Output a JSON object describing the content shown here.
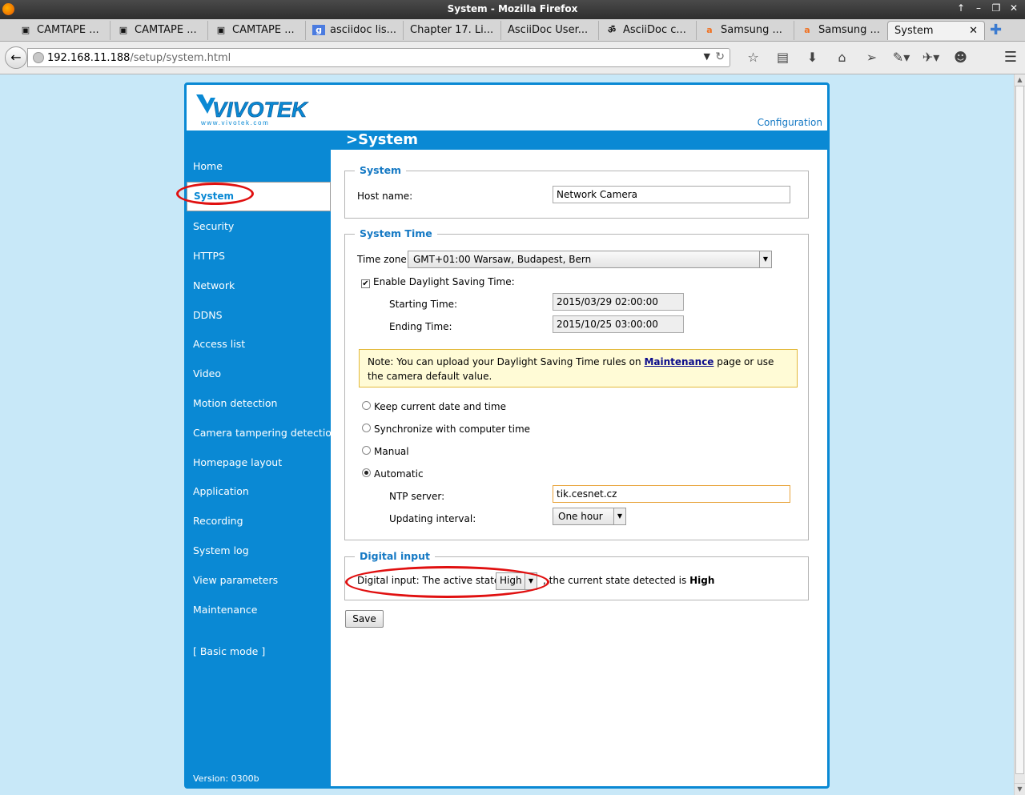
{
  "window": {
    "title": "System - Mozilla Firefox"
  },
  "tabs": [
    {
      "icon": "▣",
      "label": "CAMTAPE ..."
    },
    {
      "icon": "▣",
      "label": "CAMTAPE ..."
    },
    {
      "icon": "▣",
      "label": "CAMTAPE ..."
    },
    {
      "icon": "g",
      "label": "asciidoc lis..."
    },
    {
      "icon": "",
      "label": "Chapter 17. Li..."
    },
    {
      "icon": "",
      "label": "AsciiDoc User..."
    },
    {
      "icon": "ॐ",
      "label": "AsciiDoc c..."
    },
    {
      "icon": "a",
      "label": "Samsung ..."
    },
    {
      "icon": "a",
      "label": "Samsung ..."
    },
    {
      "icon": "",
      "label": "System"
    }
  ],
  "address": {
    "host": "192.168.11.188",
    "path": "/setup/system.html"
  },
  "page": {
    "config_link": "Configuration",
    "title": ">System",
    "version": "Version: 0300b"
  },
  "sidebar": {
    "items": [
      "Home",
      "System",
      "Security",
      "HTTPS",
      "Network",
      "DDNS",
      "Access list",
      "Video",
      "Motion detection",
      "Camera tampering detection",
      "Homepage layout",
      "Application",
      "Recording",
      "System log",
      "View parameters",
      "Maintenance"
    ],
    "basic_mode": "[ Basic mode ]"
  },
  "system": {
    "legend": "System",
    "host_label": "Host name:",
    "host_value": "Network Camera"
  },
  "time": {
    "legend": "System Time",
    "tz_label": "Time zone:",
    "tz_value": "GMT+01:00 Warsaw, Budapest, Bern",
    "dst_label": "Enable Daylight Saving Time:",
    "start_label": "Starting Time:",
    "start_value": "2015/03/29 02:00:00",
    "end_label": "Ending Time:",
    "end_value": "2015/10/25 03:00:00",
    "note_pre": "Note: You can upload your Daylight Saving Time rules on ",
    "note_link": "Maintenance",
    "note_post": " page or use the camera default value.",
    "opt_keep": "Keep current date and time",
    "opt_sync": "Synchronize with computer time",
    "opt_manual": "Manual",
    "opt_auto": "Automatic",
    "ntp_label": "NTP server:",
    "ntp_value": "tik.cesnet.cz",
    "interval_label": "Updating interval:",
    "interval_value": "One hour"
  },
  "digital": {
    "legend": "Digital input",
    "pre": "Digital input: The active state is",
    "active": "High",
    "post": ", the current state detected is",
    "current": "High"
  },
  "save_label": "Save",
  "colors": {
    "accent": "#0a89d4",
    "annotation": "#e01010"
  }
}
